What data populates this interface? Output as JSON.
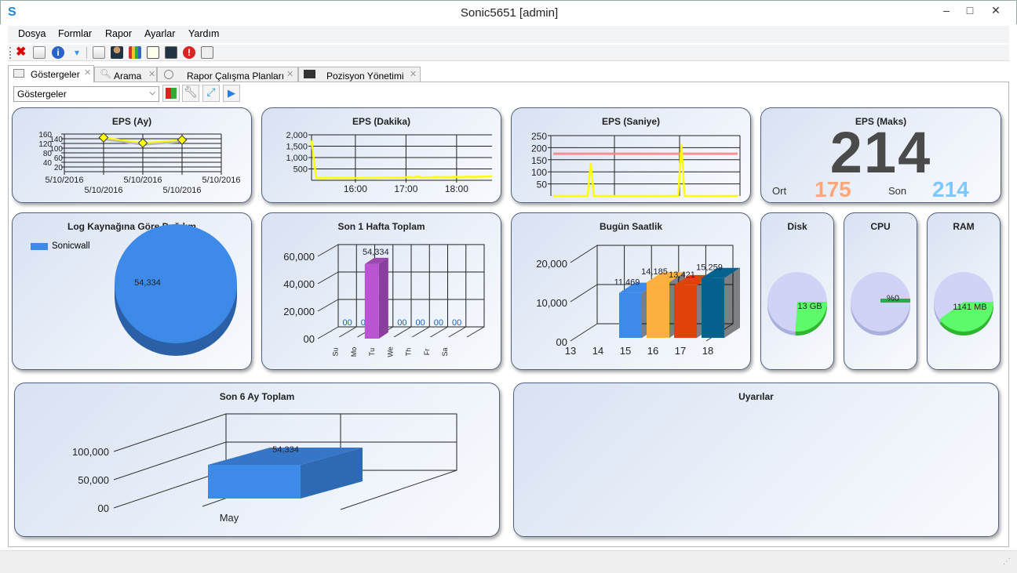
{
  "window": {
    "title": "Sonic5651 [admin]",
    "minimize": "–",
    "maximize": "□",
    "close": "✕"
  },
  "menu": [
    "Dosya",
    "Formlar",
    "Rapor",
    "Ayarlar",
    "Yardım"
  ],
  "toolbar": [
    "close-icon",
    "dashboard-icon",
    "info-icon",
    "dropdown-icon",
    "dashboard-icon",
    "user-icon",
    "bar-chart-icon",
    "presentation-icon",
    "monitor-icon",
    "alert-icon",
    "report-icon"
  ],
  "tabs": [
    {
      "label": "Göstergeler",
      "active": true
    },
    {
      "label": "Arama"
    },
    {
      "label": "Rapor Çalışma Planları"
    },
    {
      "label": "Pozisyon Yönetimi"
    }
  ],
  "dashboard_select": {
    "value": "Göstergeler"
  },
  "panels": {
    "eps_ay": "EPS (Ay)",
    "eps_dakika": "EPS (Dakika)",
    "eps_saniye": "EPS (Saniye)",
    "eps_maks": "EPS (Maks)",
    "log_kaynak": "Log Kaynağına Göre Dağılım",
    "hafta": "Son 1 Hafta Toplam",
    "saatlik": "Bugün Saatlik",
    "alti_ay": "Son 6 Ay Toplam",
    "uyarilar": "Uyarılar"
  },
  "eps_maks": {
    "max": "214",
    "avg_label": "Ort",
    "avg": "175",
    "last_label": "Son",
    "last": "214",
    "avg_color": "#ffa77a",
    "last_color": "#7fc8ff"
  },
  "gauges": [
    {
      "title": "Disk",
      "label": "13 GB",
      "fraction": 0.26
    },
    {
      "title": "CPU",
      "label": "%0",
      "fraction": 0.0
    },
    {
      "title": "RAM",
      "label": "1141 MB",
      "fraction": 0.4
    }
  ],
  "chart_data": [
    {
      "id": "eps_ay",
      "type": "line",
      "title": "EPS (Ay)",
      "x_labels": [
        "5/10/2016",
        "5/10/2016",
        "5/10/2016",
        "5/10/2016",
        "5/10/2016"
      ],
      "x_index": [
        1,
        2,
        3
      ],
      "values": [
        145,
        122,
        135
      ],
      "ylim": [
        0,
        160
      ],
      "y_ticks": [
        160,
        140,
        120,
        100,
        80,
        60,
        40,
        20
      ],
      "color": "#ffff00",
      "grid": true
    },
    {
      "id": "eps_dakika",
      "type": "line",
      "title": "EPS (Dakika)",
      "xlim": [
        "15:08",
        "18:42"
      ],
      "x_ticks": [
        "16:00",
        "17:00",
        "18:00"
      ],
      "ylim": [
        0,
        2000
      ],
      "y_ticks": [
        "2,000",
        "1,500",
        "1,000",
        "500"
      ],
      "values": [
        1750,
        110,
        95,
        100,
        105,
        98,
        102,
        100,
        108,
        104,
        100,
        106,
        110,
        105,
        112,
        108,
        115,
        110,
        118,
        112,
        120,
        150,
        130,
        165,
        125,
        140,
        130,
        150,
        135,
        145,
        140,
        155,
        145,
        150,
        160,
        148,
        165,
        155,
        170,
        180
      ],
      "color": "#ffff00",
      "grid": true
    },
    {
      "id": "eps_saniye",
      "type": "line",
      "title": "EPS (Saniye)",
      "ylim": [
        0,
        250
      ],
      "y_ticks": [
        "250",
        "200",
        "150",
        "100",
        "50"
      ],
      "values": [
        0,
        0,
        0,
        0,
        0,
        0,
        0,
        0,
        0,
        0,
        0,
        0,
        137,
        0,
        0,
        0,
        0,
        0,
        0,
        0,
        0,
        0,
        0,
        0,
        0,
        0,
        0,
        0,
        0,
        0,
        0,
        0,
        0,
        0,
        0,
        0,
        0,
        0,
        0,
        0,
        0,
        214,
        0,
        0,
        0,
        0,
        0,
        0,
        0,
        0,
        0,
        0,
        0,
        0,
        0,
        0,
        0,
        0,
        0,
        0
      ],
      "average": 175,
      "color": "#ffff00",
      "average_color": "#ff8080",
      "grid": true
    },
    {
      "id": "log_kaynak",
      "type": "pie",
      "title": "Log Kaynağına Göre Dağılım",
      "legend": [
        "Sonicwall"
      ],
      "values": [
        54334
      ],
      "labels": [
        "54,334"
      ],
      "colors": [
        "#3d8ae8"
      ],
      "legend_position": "top-left"
    },
    {
      "id": "hafta",
      "type": "bar",
      "title": "Son 1 Hafta Toplam",
      "categories": [
        "Su",
        "Mo",
        "Tu",
        "We",
        "Th",
        "Fr",
        "Sa"
      ],
      "values": [
        0,
        0,
        54334,
        0,
        0,
        0,
        0
      ],
      "labels": [
        "00",
        "00",
        "54,334",
        "00",
        "00",
        "00",
        "00"
      ],
      "y_ticks": [
        "60,000",
        "40,000",
        "20,000",
        "00"
      ],
      "ylim": [
        0,
        60000
      ],
      "color": "#b955d0"
    },
    {
      "id": "saatlik",
      "type": "bar",
      "title": "Bugün Saatlik",
      "categories": [
        "13",
        "14",
        "15",
        "16",
        "17",
        "18"
      ],
      "values": [
        null,
        11469,
        14185,
        13421,
        15259,
        null
      ],
      "labels": [
        "",
        "11,469",
        "14,185",
        "13,421",
        "15,259",
        ""
      ],
      "y_ticks": [
        "20,000",
        "10,000",
        "00"
      ],
      "ylim": [
        0,
        20000
      ],
      "colors": [
        "#3d8ae8",
        "#fbb040",
        "#e0420a",
        "#05628f"
      ]
    },
    {
      "id": "alti_ay",
      "type": "bar",
      "title": "Son 6 Ay Toplam",
      "categories": [
        "May"
      ],
      "values": [
        54334
      ],
      "labels": [
        "54,334"
      ],
      "y_ticks": [
        "100,000",
        "50,000",
        "00"
      ],
      "ylim": [
        0,
        150000
      ],
      "color": "#3d8ae8"
    }
  ]
}
